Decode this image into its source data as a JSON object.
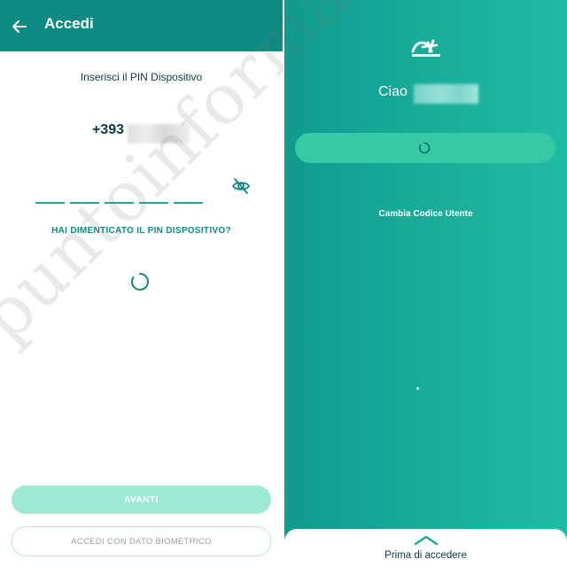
{
  "left_screen": {
    "header": {
      "title": "Accedi",
      "back_icon": "arrow-left-icon",
      "background": "#0f8a83"
    },
    "pin_heading": "Inserisci il PIN Dispositivo",
    "phone_prefix": "+393",
    "pin_slot_count": 5,
    "visibility_icon": "eye-slash-icon",
    "forgot_pin_link": "HAI DIMENTICATO IL PIN DISPOSITIVO?",
    "loading_icon": "spinner-icon",
    "primary_button": "AVANTI",
    "secondary_button": "ACCEDI CON DATO BIOMETRICO",
    "accent_color": "#1aa89a"
  },
  "right_screen": {
    "logo_icon": "credit-agricole-logo",
    "greeting": "Ciao",
    "loading_icon": "spinner-icon",
    "change_code_link": "Cambia Codice Utente",
    "bottom_sheet": {
      "chevron_icon": "chevron-up-icon",
      "label": "Prima di accedere"
    },
    "gradient_colors": [
      "#0f9a8e",
      "#20bba3"
    ]
  },
  "watermark": "puntoinformatico"
}
